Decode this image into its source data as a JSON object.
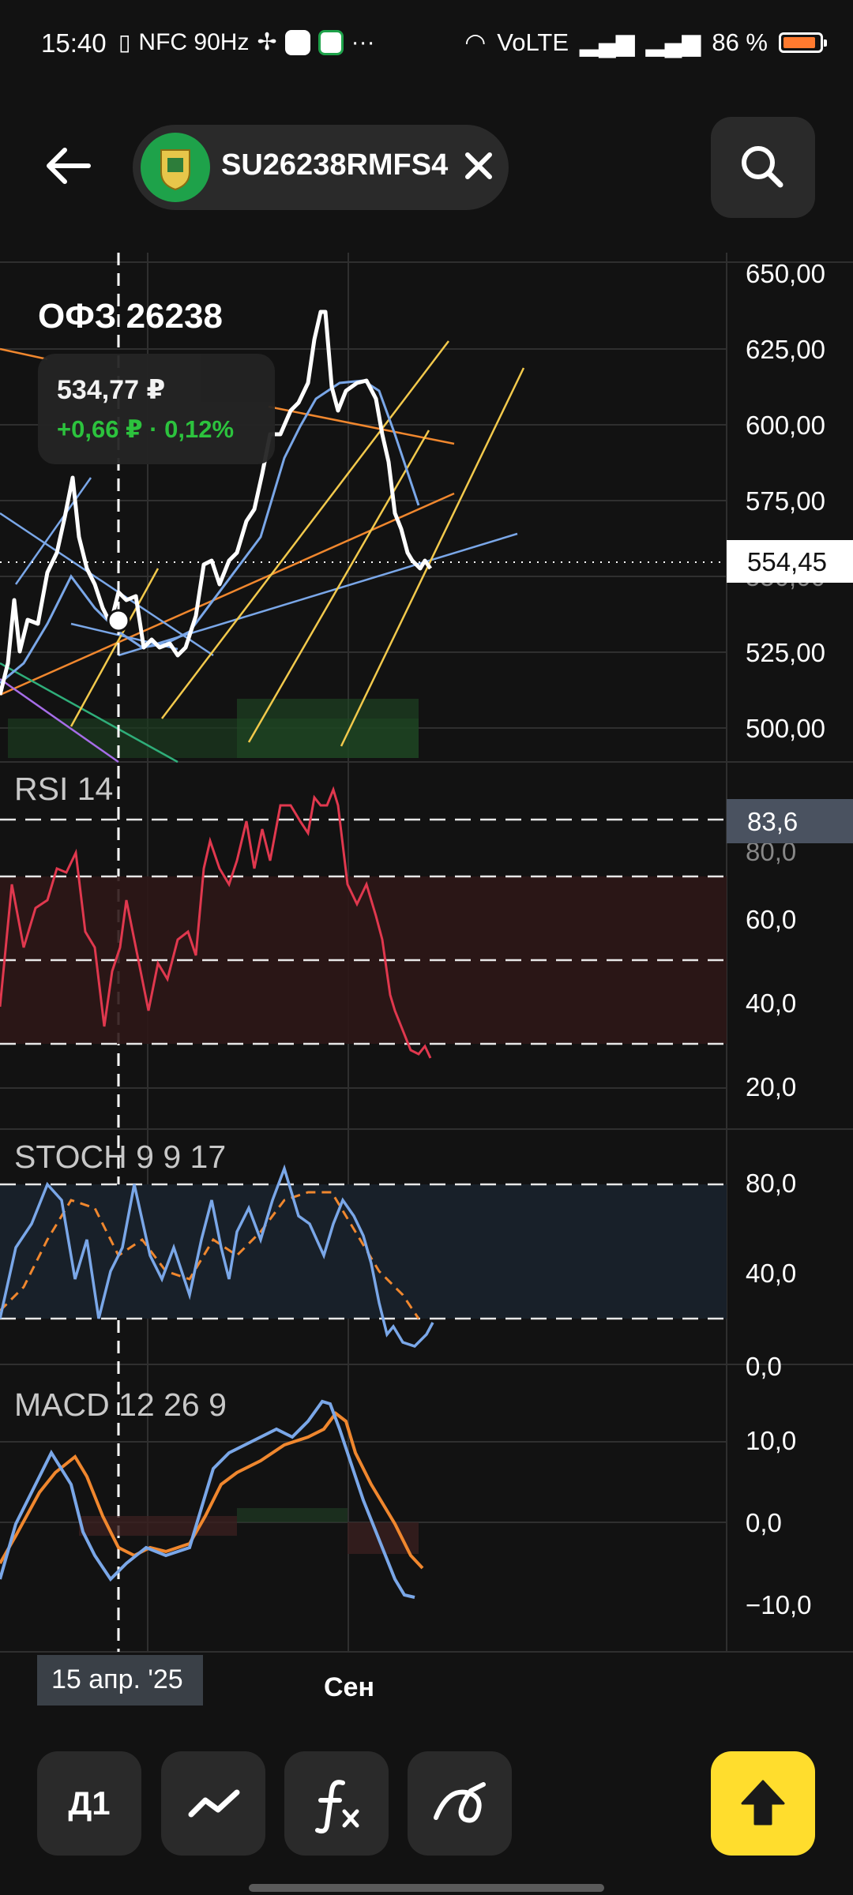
{
  "status_bar": {
    "time": "15:40",
    "left_icons_text": "NFC 90Hz",
    "network": "VoLTE",
    "battery": "86 %",
    "more": "···"
  },
  "header": {
    "ticker": "SU26238RMFS4",
    "back_icon": "arrow-left-icon",
    "close_icon": "close-icon",
    "search_icon": "search-icon"
  },
  "instrument": {
    "name": "ОФЗ 26238",
    "price": "534,77 ₽",
    "change": "+0,66 ₽ · 0,12%",
    "change_color": "#2ecc40"
  },
  "price_axis": [
    "650,00",
    "625,00",
    "600,00",
    "575,00",
    "550,00",
    "525,00",
    "500,00"
  ],
  "current_price_tag": "554,45",
  "panels": {
    "rsi": {
      "label": "RSI 14",
      "axis": [
        "80,0",
        "60,0",
        "40,0",
        "20,0"
      ],
      "tag": "83,6"
    },
    "stoch": {
      "label": "STOCH 9 9 17",
      "axis": [
        "80,0",
        "40,0",
        "0,0"
      ]
    },
    "macd": {
      "label": "MACD 12 26 9",
      "axis": [
        "10,0",
        "0,0",
        "−10,0"
      ]
    }
  },
  "x_axis": {
    "cursor_date": "15 апр. '25",
    "month": "Сен"
  },
  "toolbar": {
    "period": "Д1",
    "chart_type_icon": "line-chart-icon",
    "indicators_icon": "function-icon",
    "drawing_icon": "drawing-tool-icon",
    "trade_icon": "arrow-up-icon"
  },
  "colors": {
    "price_line": "#ffffff",
    "ma_line": "#7aa7e8",
    "rsi_line": "#e0384e",
    "stoch_k": "#7aa7e8",
    "stoch_d": "#f0872e",
    "macd_line": "#7aa7e8",
    "signal_line": "#f0872e",
    "trend_yellow": "#f2c94c",
    "trade_button": "#ffdd2d"
  }
}
